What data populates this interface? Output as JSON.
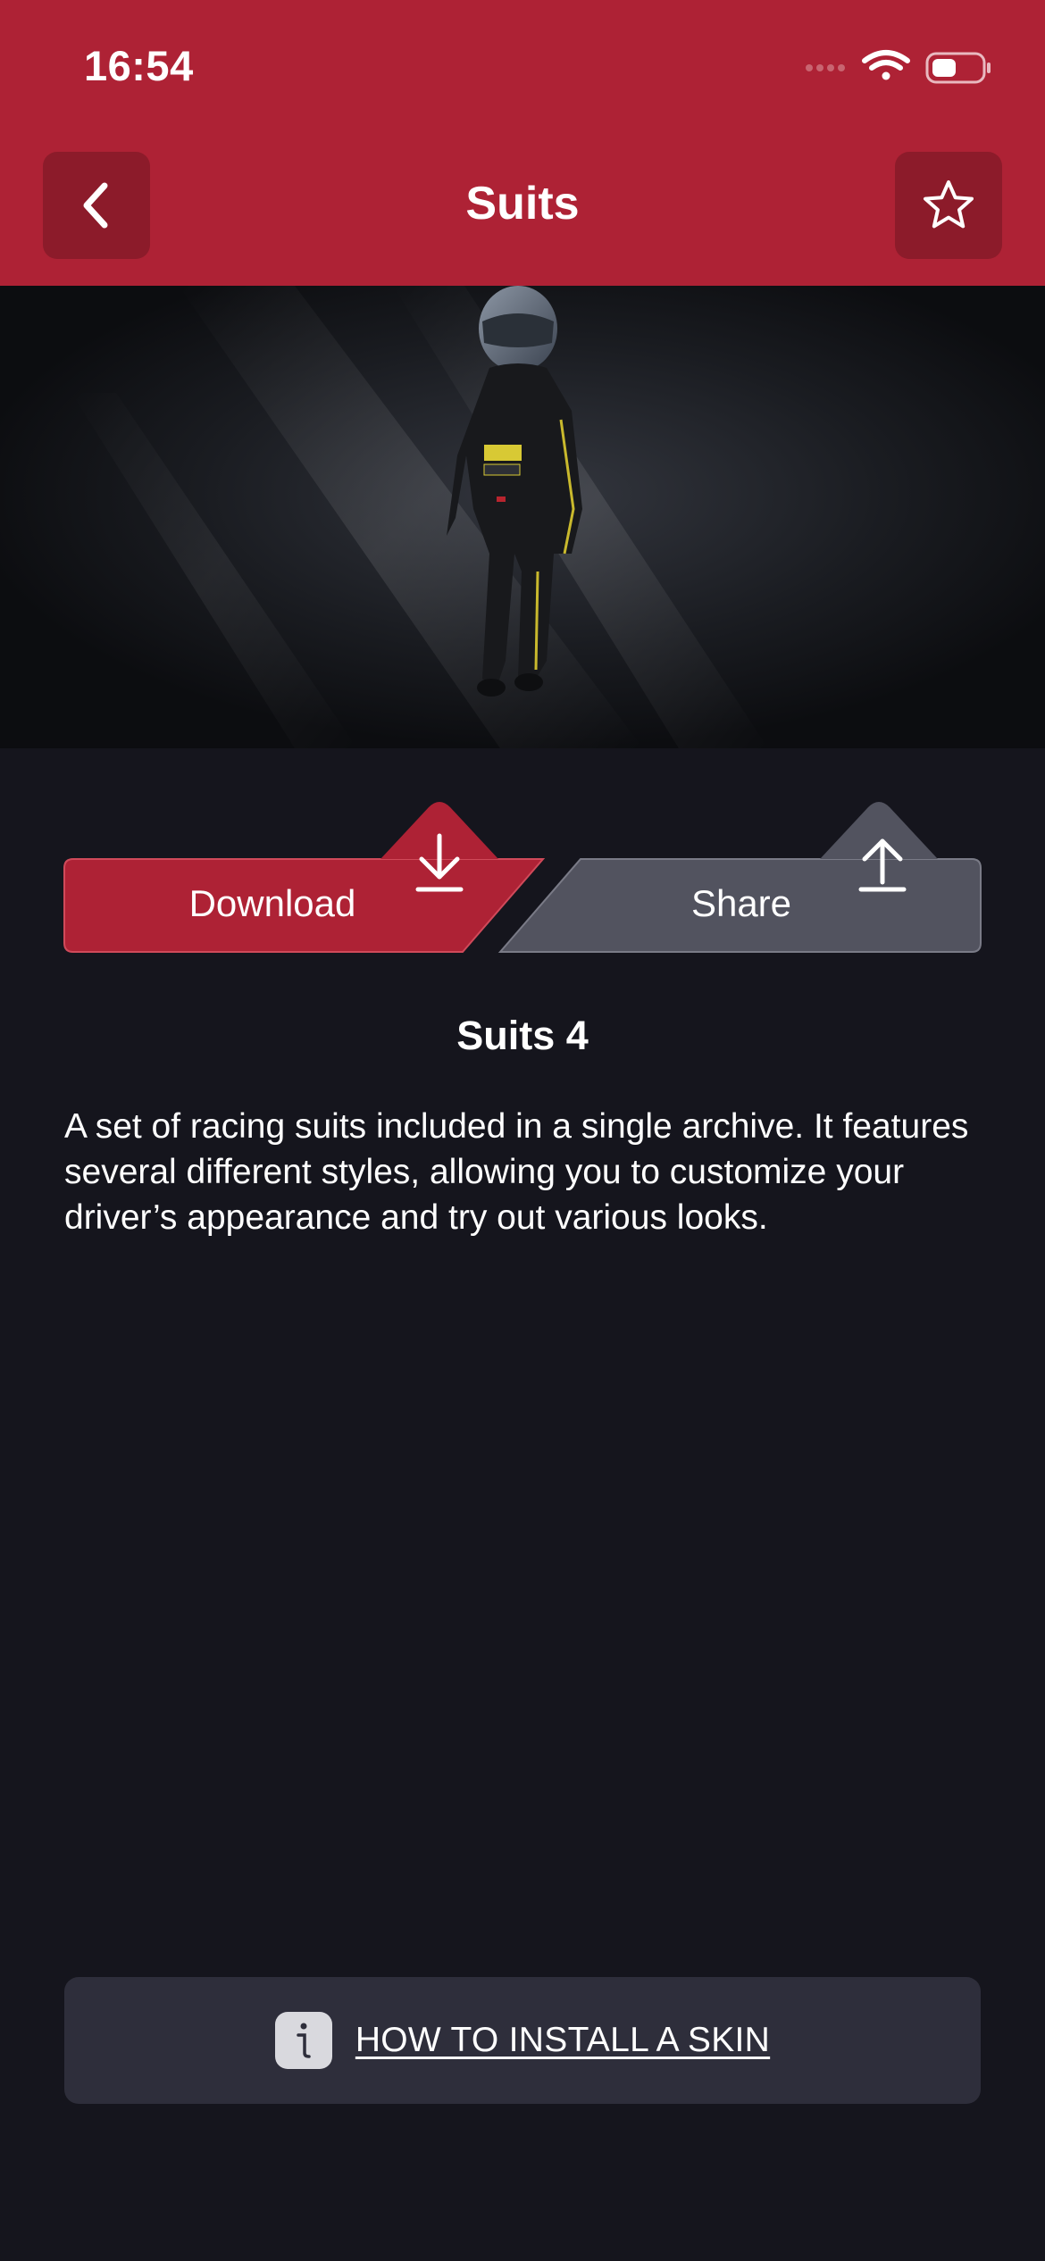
{
  "status_bar": {
    "time": "16:54"
  },
  "header": {
    "title": "Suits",
    "back_icon": "chevron-left-icon",
    "favorite_icon": "star-outline-icon",
    "background_color": "#ae2235",
    "button_color": "#8c1b2a"
  },
  "hero": {
    "image_description_icon": "racing-suit-preview"
  },
  "actions": {
    "download_label": "Download",
    "download_icon": "download-arrow-icon",
    "download_color": "#ae2235",
    "share_label": "Share",
    "share_icon": "upload-arrow-icon",
    "share_color": "#52535f"
  },
  "item": {
    "title": "Suits 4",
    "description": "A set of racing suits included in a single archive. It features several different styles, allowing you to customize your driver’s appearance and try out various looks."
  },
  "install": {
    "label": "HOW TO INSTALL A SKIN",
    "icon": "info-icon",
    "background_color": "#2e2e3b"
  },
  "page_background": "#15151d"
}
